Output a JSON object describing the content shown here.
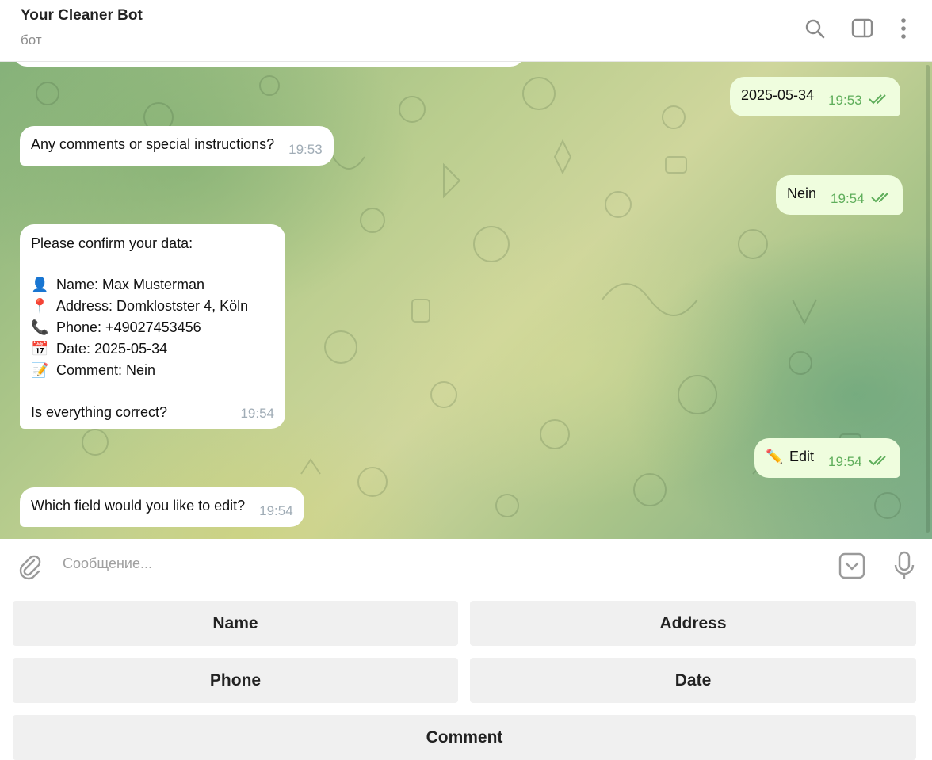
{
  "header": {
    "title": "Your Cleaner Bot",
    "subtitle": "бот",
    "icons": [
      "search-icon",
      "sidebar-toggle-icon",
      "more-vertical-icon"
    ]
  },
  "messages": [
    {
      "dir": "out",
      "text": "2025-05-34",
      "time": "19:53",
      "read": true
    },
    {
      "dir": "in",
      "text": "Any comments or special instructions?",
      "time": "19:53"
    },
    {
      "dir": "out",
      "text": "Nein",
      "time": "19:54",
      "read": true
    },
    {
      "dir": "in",
      "time": "19:54",
      "lines": [
        {
          "text": "Please confirm your data:"
        },
        {
          "text": ""
        },
        {
          "emoji": "👤",
          "text": "Name: Max Musterman"
        },
        {
          "emoji": "📍",
          "text": "Address: Domklostster 4, Köln"
        },
        {
          "emoji": "📞",
          "text": "Phone: +49027453456"
        },
        {
          "emoji": "📅",
          "text": "Date: 2025-05-34"
        },
        {
          "emoji": "📝",
          "text": "Comment: Nein"
        },
        {
          "text": ""
        },
        {
          "text": "Is everything correct?"
        }
      ]
    },
    {
      "dir": "out",
      "emoji": "✏️",
      "text": "Edit",
      "time": "19:54",
      "read": true
    },
    {
      "dir": "in",
      "text": "Which field would you like to edit?",
      "time": "19:54"
    }
  ],
  "composer": {
    "placeholder": "Сообщение..."
  },
  "keyboard": {
    "buttons": [
      "Name",
      "Address",
      "Phone",
      "Date",
      "Comment"
    ]
  },
  "colors": {
    "outgoing_bubble": "#effdde",
    "incoming_bubble": "#ffffff",
    "read_ticks": "#5fae5b",
    "key_button": "#f0f0f0"
  }
}
